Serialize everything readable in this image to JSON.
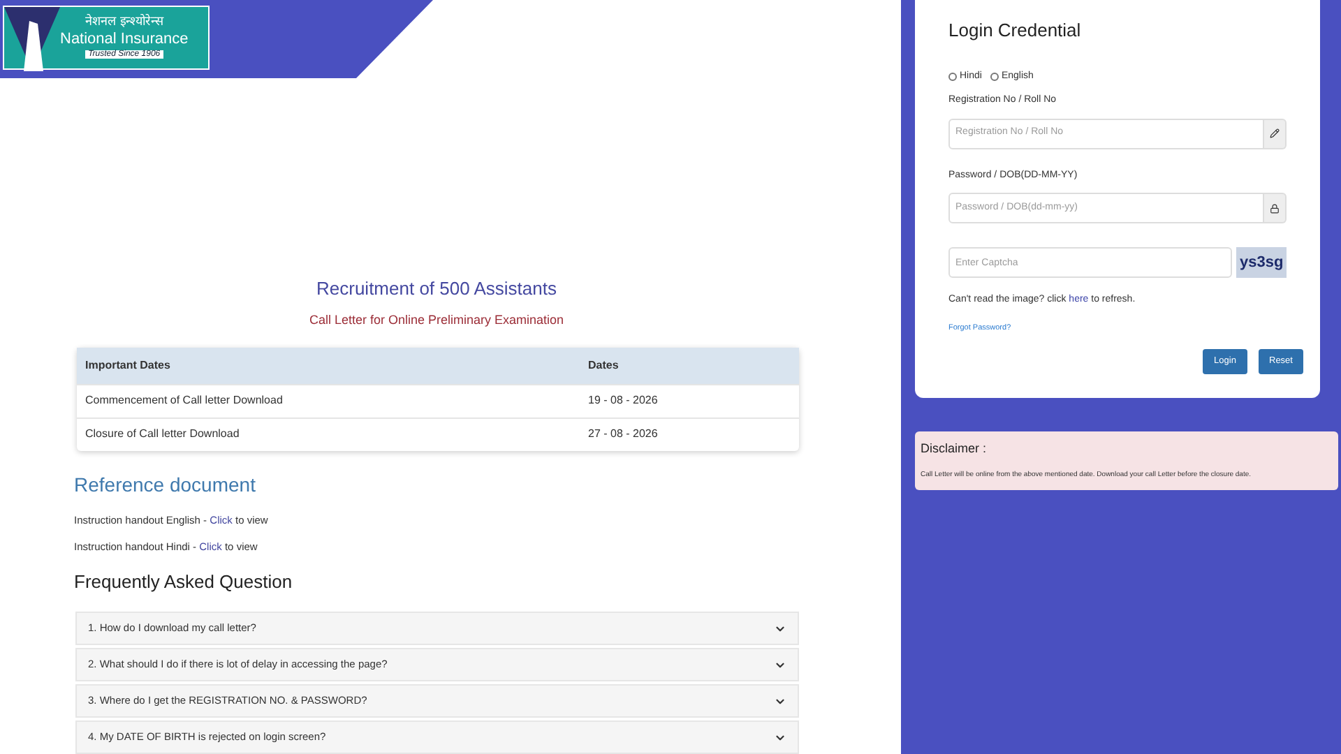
{
  "logo": {
    "hindi": "नेशनल इन्श्योरेन्स",
    "name": "National Insurance",
    "tagline": "Trusted Since 1906"
  },
  "main": {
    "title": "Recruitment of 500 Assistants",
    "subtitle": "Call Letter for Online Preliminary Examination",
    "table": {
      "columns": [
        "Important Dates",
        "Dates"
      ],
      "rows": [
        {
          "event": "Commencement of Call letter Download",
          "date": "19 - 08 - 2026"
        },
        {
          "event": "Closure of Call letter Download",
          "date": "27 - 08 - 2026"
        }
      ]
    },
    "reference": {
      "heading": "Reference document",
      "links": [
        {
          "before": "Instruction handout English - ",
          "link": "Click",
          "after": " to view"
        },
        {
          "before": "Instruction handout Hindi - ",
          "link": "Click",
          "after": " to view"
        }
      ]
    },
    "faq": {
      "heading": "Frequently Asked Question",
      "items": [
        {
          "question": "1. How do I download my call letter?",
          "expanded": false
        },
        {
          "question": "2. What should I do if there is lot of delay in accessing the page?",
          "expanded": false
        },
        {
          "question": "3. Where do I get the REGISTRATION NO. & PASSWORD?",
          "expanded": false
        },
        {
          "question": "4. My DATE OF BIRTH is rejected on login screen?",
          "expanded": false
        }
      ]
    }
  },
  "login": {
    "title": "Login Credential",
    "languages": [
      {
        "label": "Hindi",
        "selected": false
      },
      {
        "label": "English",
        "selected": false
      }
    ],
    "fields": [
      {
        "label": "Registration No / Roll No",
        "placeholder": "Registration No / Roll No",
        "kind": "text"
      },
      {
        "label": "Password / DOB(DD-MM-YY)",
        "placeholder": "Password / DOB(dd-mm-yy)",
        "kind": "password"
      }
    ],
    "captcha": {
      "placeholder": "Enter Captcha",
      "image_text": "ys3sg"
    },
    "refresh": {
      "before": "Can't read the image? click ",
      "link": "here",
      "after": " to refresh."
    },
    "forgot": "Forgot Password?",
    "buttons": [
      "Login",
      "Reset"
    ]
  },
  "disclaimer": {
    "title": "Disclaimer :",
    "text": "Call Letter will be online from the above mentioned date. Download your call Letter before the closure date."
  }
}
